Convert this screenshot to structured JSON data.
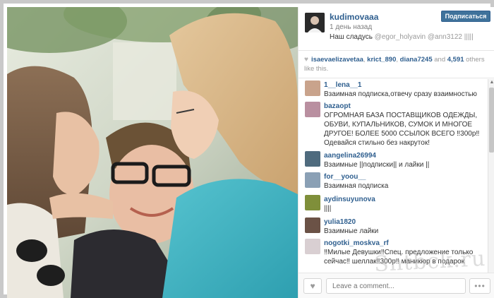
{
  "post": {
    "username": "kudimovaaa",
    "time_ago": "1 день назад",
    "caption_text": "Наш сладусь ",
    "caption_mentions": "@egor_holyavin @ann3122 |||||",
    "follow_label": "Подписаться"
  },
  "likes": {
    "icon": "heart-icon",
    "liker1": "isaevaelizavetaa",
    "sep1": ", ",
    "liker2": "krict_890",
    "sep2": ", ",
    "liker3": "diana7245",
    "and_text": " and ",
    "count": "4,591",
    "others_text": " others like this."
  },
  "comments": [
    {
      "user": "1__lena__1",
      "text": "Взаимная подписка,отвечу сразу взаимностью",
      "avatar_color": "#c9a38c"
    },
    {
      "user": "bazaopt",
      "text": "ОГРОМНАЯ БАЗА ПОСТАВЩИКОВ ОДЕЖДЫ, ОБУВИ, КУПАЛЬНИКОВ, СУМОК И МНОГОЕ ДРУГОЕ! БОЛЕЕ 5000 ССЫЛОК ВСЕГО ‼300р‼ Одевайся стильно без накруток!",
      "avatar_color": "#b98fa0"
    },
    {
      "user": "aangelina26994",
      "text": "Взаимные ||подписки|| и лайки ||",
      "avatar_color": "#4f6b7e"
    },
    {
      "user": "for__yoou__",
      "text": "Взаимная подписка",
      "avatar_color": "#8aa0b5"
    },
    {
      "user": "aydinsuyunova",
      "text": "||||",
      "avatar_color": "#7f8f3a"
    },
    {
      "user": "yulia1820",
      "text": "Взаимные лайки",
      "avatar_color": "#6b5246"
    },
    {
      "user": "nogotki_moskva_rf",
      "text": "‼Милые Девушки‼Спец. предложение только сейчас‼ шеллак‼300р‼ маникюр в подарок",
      "avatar_color": "#d9cfd2"
    }
  ],
  "footer": {
    "like_icon": "heart-icon",
    "comment_placeholder": "Leave a comment...",
    "more_label": "•••"
  },
  "watermark": "Sntbck.ru",
  "colors": {
    "link": "#2f5f8f",
    "follow_button": "#3f729b",
    "muted": "#999999"
  }
}
